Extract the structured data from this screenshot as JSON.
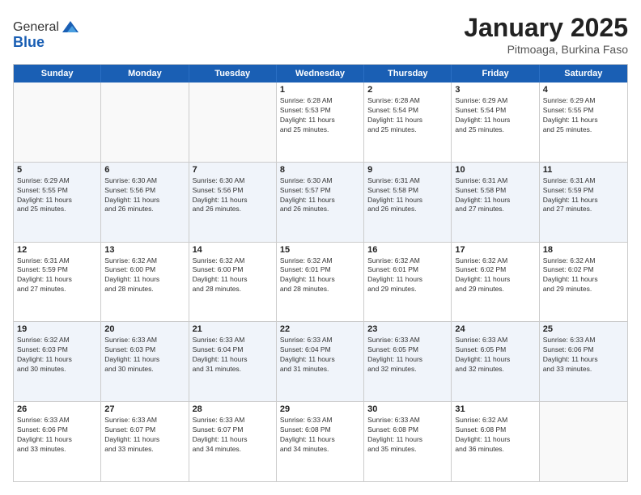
{
  "header": {
    "logo_general": "General",
    "logo_blue": "Blue",
    "month": "January 2025",
    "location": "Pitmoaga, Burkina Faso"
  },
  "weekdays": [
    "Sunday",
    "Monday",
    "Tuesday",
    "Wednesday",
    "Thursday",
    "Friday",
    "Saturday"
  ],
  "rows": [
    [
      {
        "day": "",
        "lines": []
      },
      {
        "day": "",
        "lines": []
      },
      {
        "day": "",
        "lines": []
      },
      {
        "day": "1",
        "lines": [
          "Sunrise: 6:28 AM",
          "Sunset: 5:53 PM",
          "Daylight: 11 hours",
          "and 25 minutes."
        ]
      },
      {
        "day": "2",
        "lines": [
          "Sunrise: 6:28 AM",
          "Sunset: 5:54 PM",
          "Daylight: 11 hours",
          "and 25 minutes."
        ]
      },
      {
        "day": "3",
        "lines": [
          "Sunrise: 6:29 AM",
          "Sunset: 5:54 PM",
          "Daylight: 11 hours",
          "and 25 minutes."
        ]
      },
      {
        "day": "4",
        "lines": [
          "Sunrise: 6:29 AM",
          "Sunset: 5:55 PM",
          "Daylight: 11 hours",
          "and 25 minutes."
        ]
      }
    ],
    [
      {
        "day": "5",
        "lines": [
          "Sunrise: 6:29 AM",
          "Sunset: 5:55 PM",
          "Daylight: 11 hours",
          "and 25 minutes."
        ]
      },
      {
        "day": "6",
        "lines": [
          "Sunrise: 6:30 AM",
          "Sunset: 5:56 PM",
          "Daylight: 11 hours",
          "and 26 minutes."
        ]
      },
      {
        "day": "7",
        "lines": [
          "Sunrise: 6:30 AM",
          "Sunset: 5:56 PM",
          "Daylight: 11 hours",
          "and 26 minutes."
        ]
      },
      {
        "day": "8",
        "lines": [
          "Sunrise: 6:30 AM",
          "Sunset: 5:57 PM",
          "Daylight: 11 hours",
          "and 26 minutes."
        ]
      },
      {
        "day": "9",
        "lines": [
          "Sunrise: 6:31 AM",
          "Sunset: 5:58 PM",
          "Daylight: 11 hours",
          "and 26 minutes."
        ]
      },
      {
        "day": "10",
        "lines": [
          "Sunrise: 6:31 AM",
          "Sunset: 5:58 PM",
          "Daylight: 11 hours",
          "and 27 minutes."
        ]
      },
      {
        "day": "11",
        "lines": [
          "Sunrise: 6:31 AM",
          "Sunset: 5:59 PM",
          "Daylight: 11 hours",
          "and 27 minutes."
        ]
      }
    ],
    [
      {
        "day": "12",
        "lines": [
          "Sunrise: 6:31 AM",
          "Sunset: 5:59 PM",
          "Daylight: 11 hours",
          "and 27 minutes."
        ]
      },
      {
        "day": "13",
        "lines": [
          "Sunrise: 6:32 AM",
          "Sunset: 6:00 PM",
          "Daylight: 11 hours",
          "and 28 minutes."
        ]
      },
      {
        "day": "14",
        "lines": [
          "Sunrise: 6:32 AM",
          "Sunset: 6:00 PM",
          "Daylight: 11 hours",
          "and 28 minutes."
        ]
      },
      {
        "day": "15",
        "lines": [
          "Sunrise: 6:32 AM",
          "Sunset: 6:01 PM",
          "Daylight: 11 hours",
          "and 28 minutes."
        ]
      },
      {
        "day": "16",
        "lines": [
          "Sunrise: 6:32 AM",
          "Sunset: 6:01 PM",
          "Daylight: 11 hours",
          "and 29 minutes."
        ]
      },
      {
        "day": "17",
        "lines": [
          "Sunrise: 6:32 AM",
          "Sunset: 6:02 PM",
          "Daylight: 11 hours",
          "and 29 minutes."
        ]
      },
      {
        "day": "18",
        "lines": [
          "Sunrise: 6:32 AM",
          "Sunset: 6:02 PM",
          "Daylight: 11 hours",
          "and 29 minutes."
        ]
      }
    ],
    [
      {
        "day": "19",
        "lines": [
          "Sunrise: 6:32 AM",
          "Sunset: 6:03 PM",
          "Daylight: 11 hours",
          "and 30 minutes."
        ]
      },
      {
        "day": "20",
        "lines": [
          "Sunrise: 6:33 AM",
          "Sunset: 6:03 PM",
          "Daylight: 11 hours",
          "and 30 minutes."
        ]
      },
      {
        "day": "21",
        "lines": [
          "Sunrise: 6:33 AM",
          "Sunset: 6:04 PM",
          "Daylight: 11 hours",
          "and 31 minutes."
        ]
      },
      {
        "day": "22",
        "lines": [
          "Sunrise: 6:33 AM",
          "Sunset: 6:04 PM",
          "Daylight: 11 hours",
          "and 31 minutes."
        ]
      },
      {
        "day": "23",
        "lines": [
          "Sunrise: 6:33 AM",
          "Sunset: 6:05 PM",
          "Daylight: 11 hours",
          "and 32 minutes."
        ]
      },
      {
        "day": "24",
        "lines": [
          "Sunrise: 6:33 AM",
          "Sunset: 6:05 PM",
          "Daylight: 11 hours",
          "and 32 minutes."
        ]
      },
      {
        "day": "25",
        "lines": [
          "Sunrise: 6:33 AM",
          "Sunset: 6:06 PM",
          "Daylight: 11 hours",
          "and 33 minutes."
        ]
      }
    ],
    [
      {
        "day": "26",
        "lines": [
          "Sunrise: 6:33 AM",
          "Sunset: 6:06 PM",
          "Daylight: 11 hours",
          "and 33 minutes."
        ]
      },
      {
        "day": "27",
        "lines": [
          "Sunrise: 6:33 AM",
          "Sunset: 6:07 PM",
          "Daylight: 11 hours",
          "and 33 minutes."
        ]
      },
      {
        "day": "28",
        "lines": [
          "Sunrise: 6:33 AM",
          "Sunset: 6:07 PM",
          "Daylight: 11 hours",
          "and 34 minutes."
        ]
      },
      {
        "day": "29",
        "lines": [
          "Sunrise: 6:33 AM",
          "Sunset: 6:08 PM",
          "Daylight: 11 hours",
          "and 34 minutes."
        ]
      },
      {
        "day": "30",
        "lines": [
          "Sunrise: 6:33 AM",
          "Sunset: 6:08 PM",
          "Daylight: 11 hours",
          "and 35 minutes."
        ]
      },
      {
        "day": "31",
        "lines": [
          "Sunrise: 6:32 AM",
          "Sunset: 6:08 PM",
          "Daylight: 11 hours",
          "and 36 minutes."
        ]
      },
      {
        "day": "",
        "lines": []
      }
    ]
  ]
}
